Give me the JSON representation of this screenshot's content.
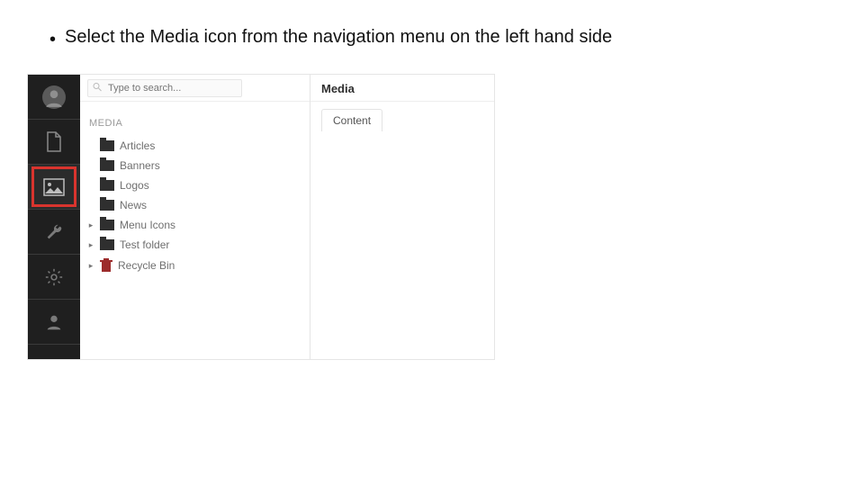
{
  "instruction": "Select the Media icon from the navigation menu on the left hand side",
  "search": {
    "placeholder": "Type to search..."
  },
  "section_label": "MEDIA",
  "tree": [
    {
      "caret": "",
      "icon": "folder",
      "label": "Articles"
    },
    {
      "caret": "",
      "icon": "folder",
      "label": "Banners"
    },
    {
      "caret": "",
      "icon": "folder",
      "label": "Logos"
    },
    {
      "caret": "",
      "icon": "folder",
      "label": "News"
    },
    {
      "caret": "▸",
      "icon": "folder",
      "label": "Menu Icons"
    },
    {
      "caret": "▸",
      "icon": "folder",
      "label": "Test folder"
    },
    {
      "caret": "▸",
      "icon": "trash",
      "label": "Recycle Bin"
    }
  ],
  "detail": {
    "title": "Media",
    "tab": "Content"
  }
}
